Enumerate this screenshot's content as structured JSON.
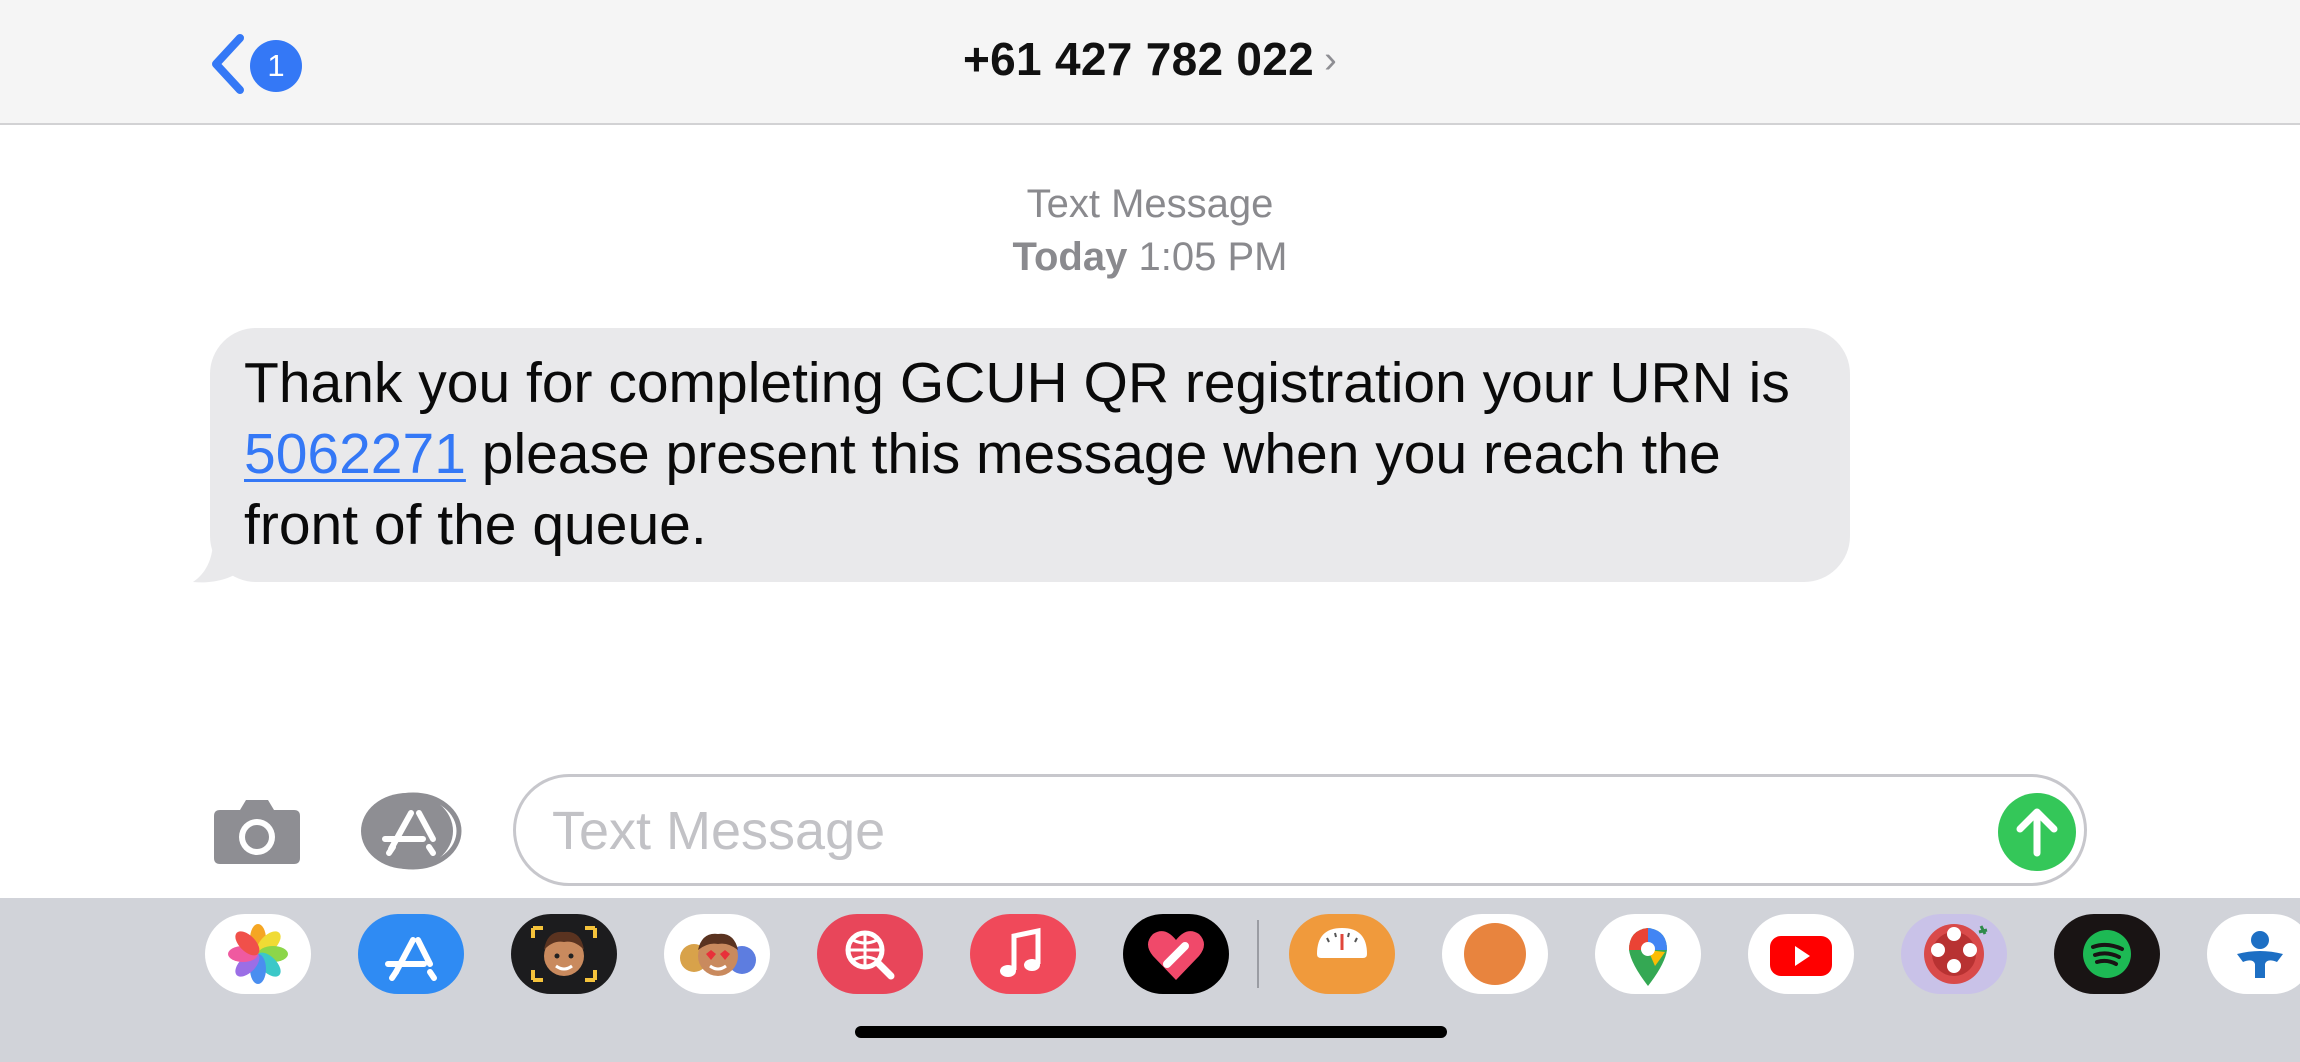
{
  "navbar": {
    "back_badge": "1",
    "title": "+61 427 782 022",
    "title_chevron": "›"
  },
  "conversation": {
    "header_label": "Text Message",
    "header_day": "Today",
    "header_time": "1:05 PM",
    "message": {
      "text_before": "Thank you for completing GCUH QR registration your URN is ",
      "urn": "5062271",
      "text_after": " please present this message when you reach the front of the queue."
    }
  },
  "compose": {
    "placeholder": "Text Message",
    "value": "",
    "camera_icon": "camera-icon",
    "apps_icon": "app-store-icon",
    "send_icon": "arrow-up-icon"
  },
  "app_drawer": {
    "apps": [
      {
        "name": "photos",
        "icon": "photos-icon"
      },
      {
        "name": "app-store",
        "icon": "app-store-icon"
      },
      {
        "name": "memoji",
        "icon": "memoji-icon"
      },
      {
        "name": "memoji-stickers",
        "icon": "memoji-stickers-icon"
      },
      {
        "name": "images-search",
        "icon": "globe-search-icon"
      },
      {
        "name": "music",
        "icon": "music-note-icon"
      },
      {
        "name": "digital-touch",
        "icon": "heart-touch-icon"
      },
      {
        "name": "scale-app",
        "icon": "scale-icon"
      },
      {
        "name": "orange-app",
        "icon": "orange-circle-icon"
      },
      {
        "name": "google-maps",
        "icon": "map-pin-icon"
      },
      {
        "name": "youtube",
        "icon": "youtube-icon"
      },
      {
        "name": "word-game",
        "icon": "word-game-icon"
      },
      {
        "name": "spotify",
        "icon": "spotify-icon"
      },
      {
        "name": "blue-app",
        "icon": "person-icon"
      }
    ]
  },
  "colors": {
    "accent_blue": "#3478f6",
    "send_green": "#34c759",
    "bubble_gray": "#e9e9eb",
    "drawer_gray": "#d1d3d9"
  }
}
